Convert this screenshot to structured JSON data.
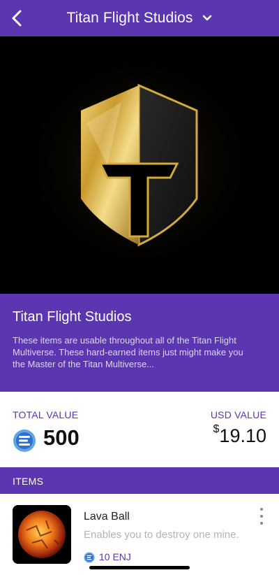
{
  "header": {
    "title": "Titan Flight Studios",
    "back_icon": "chevron-left-icon",
    "dropdown_icon": "chevron-down-icon"
  },
  "hero": {
    "logo": "titan-shield-logo"
  },
  "info": {
    "title": "Titan Flight Studios",
    "description": "These items are usable throughout all of the Titan Flight Multiverse. These hard-earned  items just might make you the Master of the Titan Multiverse..."
  },
  "values": {
    "total_label": "TOTAL VALUE",
    "total_amount": "500",
    "usd_label": "USD VALUE",
    "usd_symbol": "$",
    "usd_amount": "19.10"
  },
  "items_section": {
    "label": "ITEMS"
  },
  "items": [
    {
      "name": "Lava Ball",
      "description": "Enables you to destroy one mine.",
      "price": "10 ENJ"
    }
  ],
  "colors": {
    "accent": "#5b36b0",
    "gold": "#d4aa3c"
  }
}
